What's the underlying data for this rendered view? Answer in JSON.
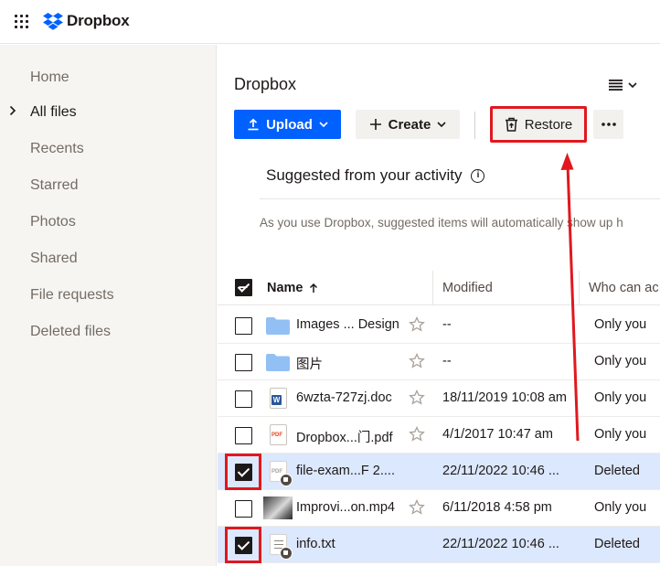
{
  "brand": {
    "name": "Dropbox"
  },
  "sidebar": {
    "items": [
      {
        "label": "Home"
      },
      {
        "label": "All files"
      },
      {
        "label": "Recents"
      },
      {
        "label": "Starred"
      },
      {
        "label": "Photos"
      },
      {
        "label": "Shared"
      },
      {
        "label": "File requests"
      },
      {
        "label": "Deleted files"
      }
    ]
  },
  "main": {
    "breadcrumb": "Dropbox",
    "toolbar": {
      "upload_label": "Upload",
      "create_label": "Create",
      "restore_label": "Restore"
    },
    "suggested": {
      "title": "Suggested from your activity",
      "description": "As you use Dropbox, suggested items will automatically show up h"
    },
    "table": {
      "columns": {
        "name": "Name",
        "modified": "Modified",
        "who": "Who can ac"
      },
      "rows": [
        {
          "name": "Images ... Design",
          "modified": "--",
          "who": "Only you"
        },
        {
          "name": "图片",
          "modified": "--",
          "who": "Only you"
        },
        {
          "name": "6wzta-727zj.doc",
          "modified": "18/11/2019 10:08 am",
          "who": "Only you"
        },
        {
          "name": "Dropbox...门.pdf",
          "modified": "4/1/2017 10:47 am",
          "who": "Only you"
        },
        {
          "name": "file-exam...F 2....",
          "modified": "22/11/2022 10:46 ...",
          "who": "Deleted"
        },
        {
          "name": "Improvi...on.mp4",
          "modified": "6/11/2018 4:58 pm",
          "who": "Only you"
        },
        {
          "name": "info.txt",
          "modified": "22/11/2022 10:46 ...",
          "who": "Deleted"
        }
      ]
    }
  },
  "colors": {
    "accent": "#0061fe",
    "highlight": "#e0181f",
    "selected_row": "#dbe8fd"
  }
}
